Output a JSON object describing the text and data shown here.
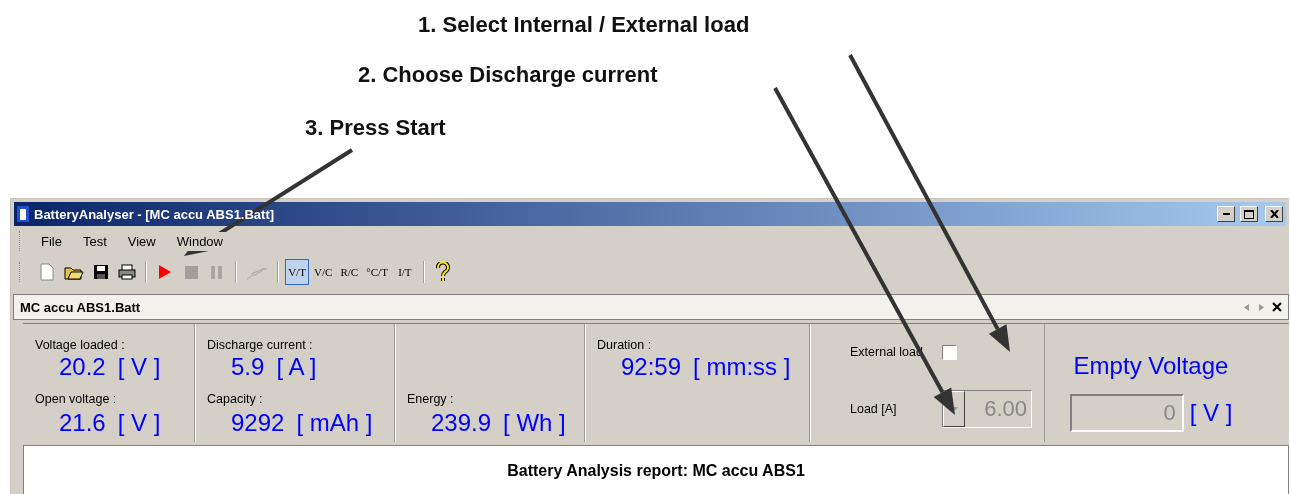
{
  "annotations": [
    {
      "text": "1. Select Internal / External load"
    },
    {
      "text": "2. Choose Discharge current"
    },
    {
      "text": "3. Press Start"
    }
  ],
  "window": {
    "title": "BatteryAnalyser - [MC accu ABS1.Batt]"
  },
  "menu": [
    "File",
    "Test",
    "View",
    "Window"
  ],
  "toolbar": [
    {
      "kind": "new",
      "disabled": false
    },
    {
      "kind": "open",
      "disabled": false
    },
    {
      "kind": "save",
      "disabled": false
    },
    {
      "kind": "print",
      "disabled": false
    },
    {
      "kind": "separator"
    },
    {
      "kind": "start",
      "disabled": false
    },
    {
      "kind": "stop",
      "disabled": true
    },
    {
      "kind": "pause",
      "disabled": true
    },
    {
      "kind": "separator"
    },
    {
      "kind": "curve",
      "disabled": true
    },
    {
      "kind": "separator"
    },
    {
      "kind": "chart",
      "label": "V/T",
      "selected": true
    },
    {
      "kind": "chart",
      "label": "V/C",
      "selected": false
    },
    {
      "kind": "chart",
      "label": "R/C",
      "selected": false
    },
    {
      "kind": "chart",
      "label": "°C/T",
      "selected": false
    },
    {
      "kind": "chart",
      "label": "I/T",
      "selected": false
    },
    {
      "kind": "separator"
    },
    {
      "kind": "help",
      "disabled": false
    }
  ],
  "document_tab": {
    "label": "MC accu ABS1.Batt"
  },
  "readings": [
    {
      "top": {
        "label": "Voltage loaded :",
        "value": "20.2",
        "unit": "[ V ]"
      },
      "bottom": {
        "label": "Open voltage :",
        "value": "21.6",
        "unit": "[ V ]"
      }
    },
    {
      "top": {
        "label": "Discharge current :",
        "value": "5.9",
        "unit": "[ A ]"
      },
      "bottom": {
        "label": "Capacity :",
        "value": "9292",
        "unit": "[ mAh ]"
      }
    },
    {
      "bottom": {
        "label": "Energy :",
        "value": "239.9",
        "unit": "[ Wh ]"
      }
    },
    {
      "top": {
        "label": "Duration :",
        "value": "92:59",
        "unit": "[ mm:ss ]"
      }
    }
  ],
  "load": {
    "external_label": "External load",
    "external_checked": false,
    "load_label": "Load  [A]",
    "load_value": "6.00",
    "disabled": true
  },
  "empty_voltage": {
    "title": "Empty Voltage",
    "value": "0",
    "unit": "[ V ]",
    "disabled": true
  },
  "report": {
    "title": "Battery Analysis report: MC accu ABS1"
  }
}
